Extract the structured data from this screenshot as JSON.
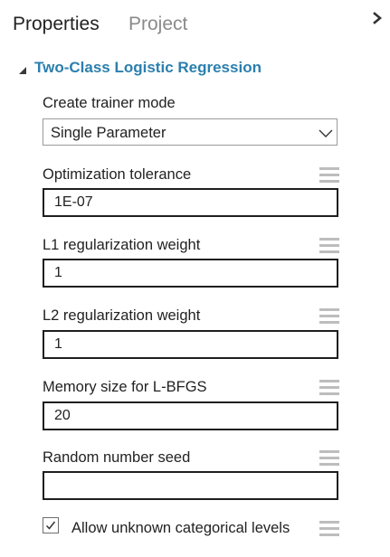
{
  "tabs": {
    "properties": "Properties",
    "project": "Project"
  },
  "icons": {
    "collapse": "chevron-right-icon",
    "section_toggle": "caret-down-icon",
    "dropdown": "chevron-down-icon",
    "drag_handle": "drag-handle-icon",
    "checkbox": "checkmark-icon"
  },
  "colors": {
    "section_title": "#2b7fae",
    "inactive_tab": "#8a8a8a",
    "handle": "#bdbdbd"
  },
  "section": {
    "title": "Two-Class Logistic Regression"
  },
  "trainer_mode": {
    "label": "Create trainer mode",
    "value": "Single Parameter"
  },
  "params": [
    {
      "label": "Optimization tolerance",
      "value": "1E-07"
    },
    {
      "label": "L1 regularization weight",
      "value": "1"
    },
    {
      "label": "L2 regularization weight",
      "value": "1"
    },
    {
      "label": "Memory size for L-BFGS",
      "value": "20"
    },
    {
      "label": "Random number seed",
      "value": ""
    }
  ],
  "allow_unknown": {
    "label": "Allow unknown categorical levels",
    "checked": true
  }
}
